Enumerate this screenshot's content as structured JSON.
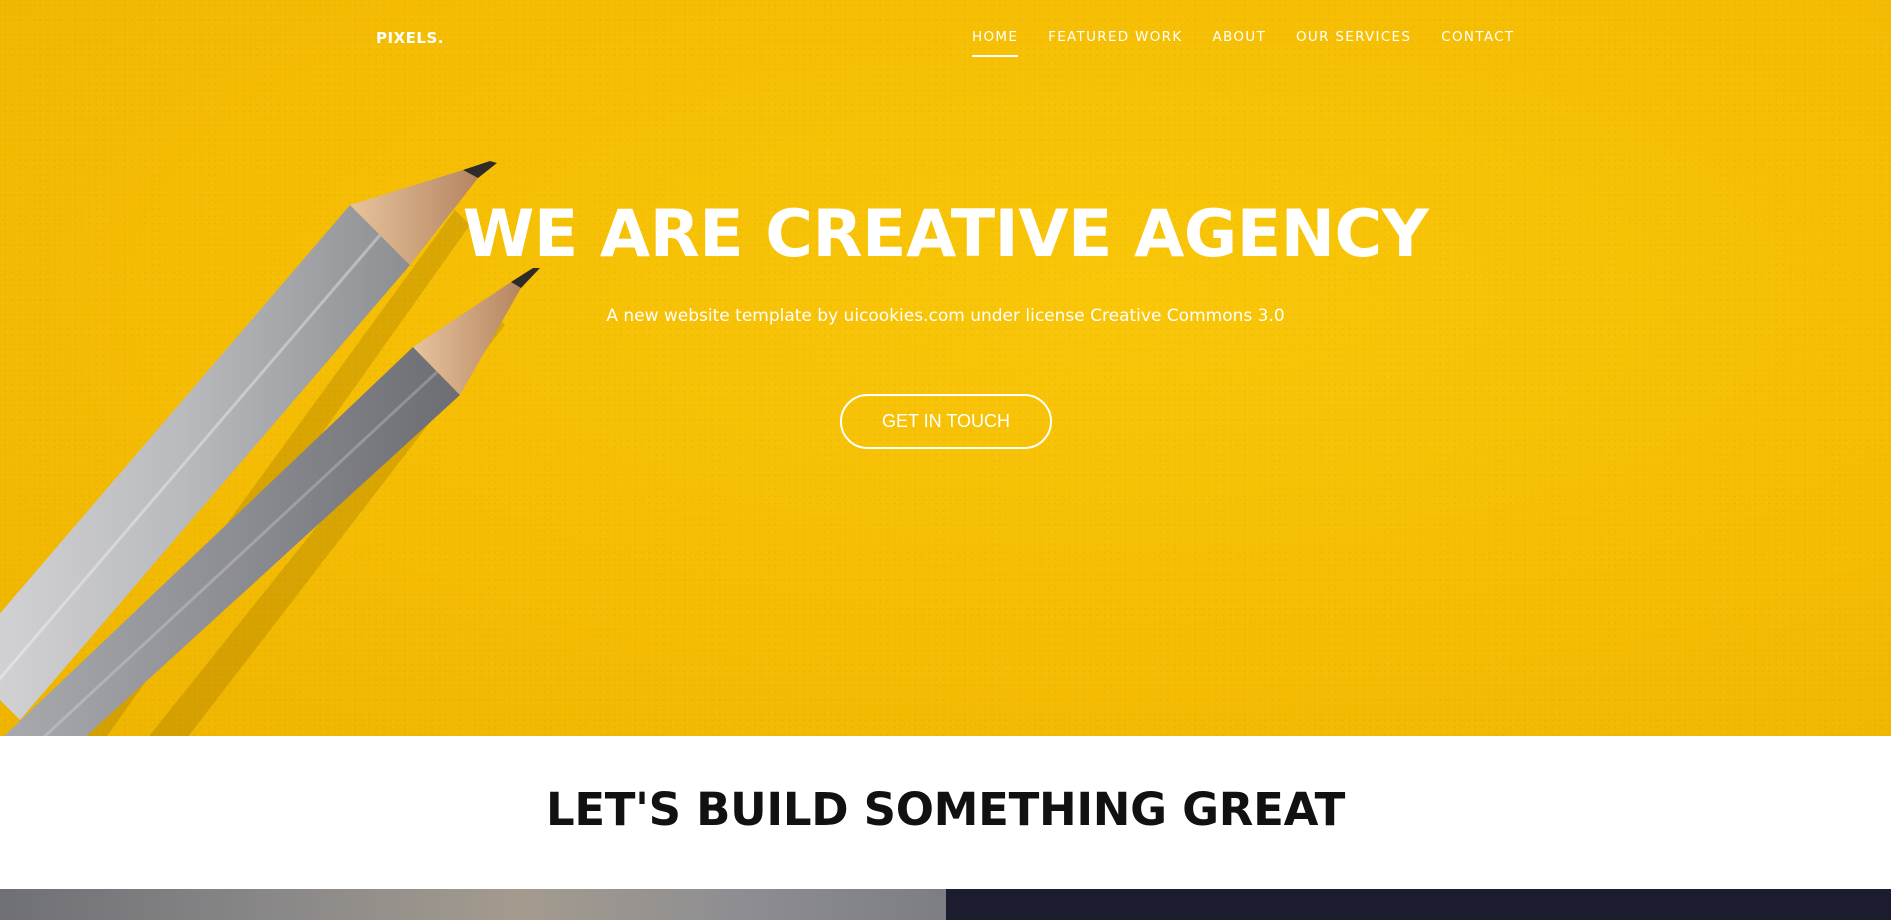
{
  "brand": {
    "logo": "PIXELS."
  },
  "nav": {
    "items": [
      {
        "label": "HOME",
        "active": true
      },
      {
        "label": "FEATURED WORK",
        "active": false
      },
      {
        "label": "ABOUT",
        "active": false
      },
      {
        "label": "OUR SERVICES",
        "active": false
      },
      {
        "label": "CONTACT",
        "active": false
      }
    ]
  },
  "hero": {
    "title": "WE ARE CREATIVE AGENCY",
    "subtitle": "A new website template by uicookies.com under license Creative Commons 3.0",
    "cta_label": "GET IN TOUCH",
    "background_color": "#f5bd02"
  },
  "section": {
    "title": "LET'S BUILD SOMETHING GREAT"
  },
  "colors": {
    "accent": "#f5bd02",
    "dark_panel": "#1b1c2d",
    "text_dark": "#111111"
  }
}
